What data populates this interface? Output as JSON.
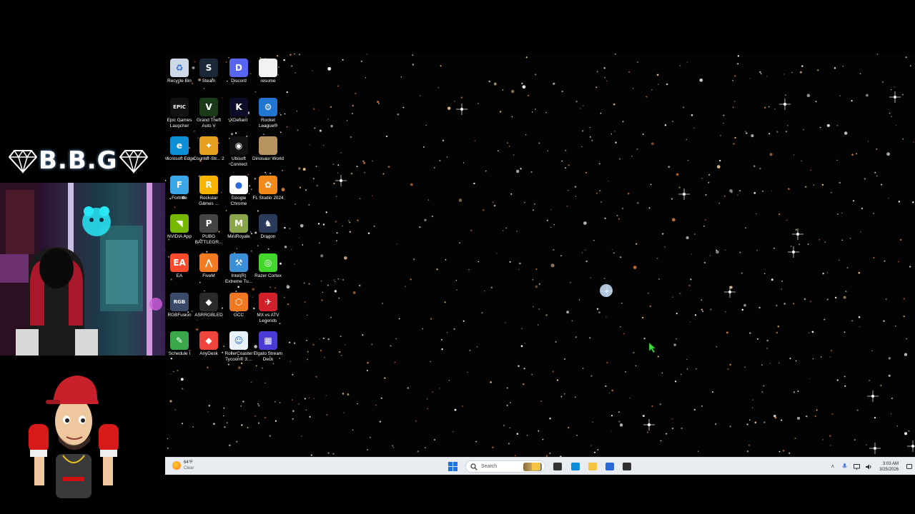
{
  "overlay": {
    "brand": "B.B.G"
  },
  "desktop": {
    "icons": [
      {
        "label": "Recycle Bin",
        "icon": "recycle-bin-icon",
        "color": "#cfd8e6",
        "glyph": "♻"
      },
      {
        "label": "Steam",
        "icon": "steam-icon",
        "color": "#1b2838",
        "glyph": "S"
      },
      {
        "label": "Discord",
        "icon": "discord-icon",
        "color": "#5865f2",
        "glyph": "D"
      },
      {
        "label": "resume",
        "icon": "document-icon",
        "color": "#f2f2f2",
        "glyph": ""
      },
      {
        "label": "Epic Games Launcher",
        "icon": "epic-games-icon",
        "color": "#111111",
        "glyph": "EPIC"
      },
      {
        "label": "Grand Theft Auto V",
        "icon": "gta-v-icon",
        "color": "#1a3a1a",
        "glyph": "V"
      },
      {
        "label": "XDefiant",
        "icon": "xdefiant-icon",
        "color": "#0d0d2a",
        "glyph": "K"
      },
      {
        "label": "Rocket League®",
        "icon": "rocket-league-icon",
        "color": "#2176d2",
        "glyph": "⚙"
      },
      {
        "label": "Microsoft Edge",
        "icon": "edge-icon",
        "color": "#0c8fd6",
        "glyph": "e"
      },
      {
        "label": "Counter-Str... 2",
        "icon": "counter-strike-icon",
        "color": "#e8a020",
        "glyph": "✦"
      },
      {
        "label": "Ubisoft Connect",
        "icon": "ubisoft-icon",
        "color": "#111111",
        "glyph": "◉"
      },
      {
        "label": "Dinosaur World",
        "icon": "dinosaur-world-icon",
        "color": "#b89460",
        "glyph": ""
      },
      {
        "label": "Fortnite",
        "icon": "fortnite-icon",
        "color": "#3aa8e8",
        "glyph": "F"
      },
      {
        "label": "Rockstar Games ...",
        "icon": "rockstar-icon",
        "color": "#f6b400",
        "glyph": "R"
      },
      {
        "label": "Google Chrome",
        "icon": "chrome-icon",
        "color": "#ffffff",
        "glyph": "●"
      },
      {
        "label": "FL Studio 2024",
        "icon": "fl-studio-icon",
        "color": "#f28a1b",
        "glyph": "✿"
      },
      {
        "label": "NVIDIA App",
        "icon": "nvidia-icon",
        "color": "#76b900",
        "glyph": "◥"
      },
      {
        "label": "PUBG BATTLEGR...",
        "icon": "pubg-icon",
        "color": "#444444",
        "glyph": "P"
      },
      {
        "label": "MiniRoyale",
        "icon": "miniroyale-icon",
        "color": "#8aa64a",
        "glyph": "M"
      },
      {
        "label": "Dragon",
        "icon": "dragon-icon",
        "color": "#2a3a5a",
        "glyph": "♞"
      },
      {
        "label": "EA",
        "icon": "ea-icon",
        "color": "#ff4b2b",
        "glyph": "EA"
      },
      {
        "label": "FiveM",
        "icon": "fivem-icon",
        "color": "#f47b20",
        "glyph": "⋀"
      },
      {
        "label": "Intel(R) Extreme Tu...",
        "icon": "intel-xtu-icon",
        "color": "#3a8fd6",
        "glyph": "⚒"
      },
      {
        "label": "Razer Cortex",
        "icon": "razer-cortex-icon",
        "color": "#44d62c",
        "glyph": "◎"
      },
      {
        "label": "RGBFusion",
        "icon": "rgbfusion-icon",
        "color": "#3a4a6a",
        "glyph": "RGB"
      },
      {
        "label": "ASRRGBLED",
        "icon": "asrrgbled-icon",
        "color": "#2a2a2a",
        "glyph": "◆"
      },
      {
        "label": "GCC",
        "icon": "gcc-icon",
        "color": "#f07820",
        "glyph": "⬡"
      },
      {
        "label": "MX vs ATV Legends",
        "icon": "mx-vs-atv-icon",
        "color": "#d0202a",
        "glyph": "✈"
      },
      {
        "label": "Schedule I",
        "icon": "schedule-one-icon",
        "color": "#3aa84a",
        "glyph": "✎"
      },
      {
        "label": "AnyDesk",
        "icon": "anydesk-icon",
        "color": "#ef443b",
        "glyph": "◆"
      },
      {
        "label": "RollerCoaster Tycoon® 3:...",
        "icon": "rollercoaster-tycoon-icon",
        "color": "#e8f0f8",
        "glyph": "☺"
      },
      {
        "label": "Elgato Stream Deck",
        "icon": "stream-deck-icon",
        "color": "#4a3ad6",
        "glyph": "▦"
      }
    ]
  },
  "taskbar": {
    "weather": {
      "temp": "64°F",
      "condition": "Clear"
    },
    "search_placeholder": "Search",
    "pinned": [
      {
        "name": "file-explorer-folder-icon",
        "color": "#f5c542"
      },
      {
        "name": "task-view-icon",
        "color": "#333333"
      },
      {
        "name": "edge-taskbar-icon",
        "color": "#0c8fd6"
      },
      {
        "name": "file-explorer-icon",
        "color": "#f5c542"
      },
      {
        "name": "store-icon",
        "color": "#2a6ad6"
      },
      {
        "name": "obs-recording-icon",
        "color": "#303030"
      }
    ],
    "clock": {
      "time": "3:03 AM",
      "date": "3/25/2026"
    }
  }
}
